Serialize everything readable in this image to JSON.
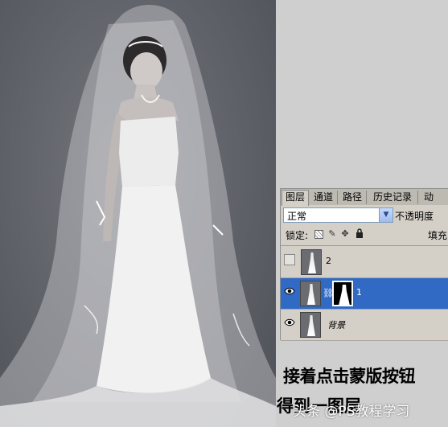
{
  "panel": {
    "tabs": [
      "图层",
      "通道",
      "路径",
      "历史记录",
      "动"
    ],
    "blend_mode": "正常",
    "opacity_label": "不透明度",
    "lock_label": "锁定:",
    "fill_label": "填充",
    "layers": [
      {
        "name": "2",
        "visible": false,
        "selected": false,
        "has_mask": false
      },
      {
        "name": "1",
        "visible": true,
        "selected": true,
        "has_mask": true
      },
      {
        "name": "背景",
        "visible": true,
        "selected": false,
        "has_mask": false
      }
    ]
  },
  "captions": {
    "line1": "接着点击蒙版按钮",
    "line2": "得到一图层",
    "watermark": "头条 @PS教程学习"
  },
  "colors": {
    "backdrop": "#5f6168",
    "panel_bg": "#d4d0c8",
    "selection": "#316ac5"
  }
}
